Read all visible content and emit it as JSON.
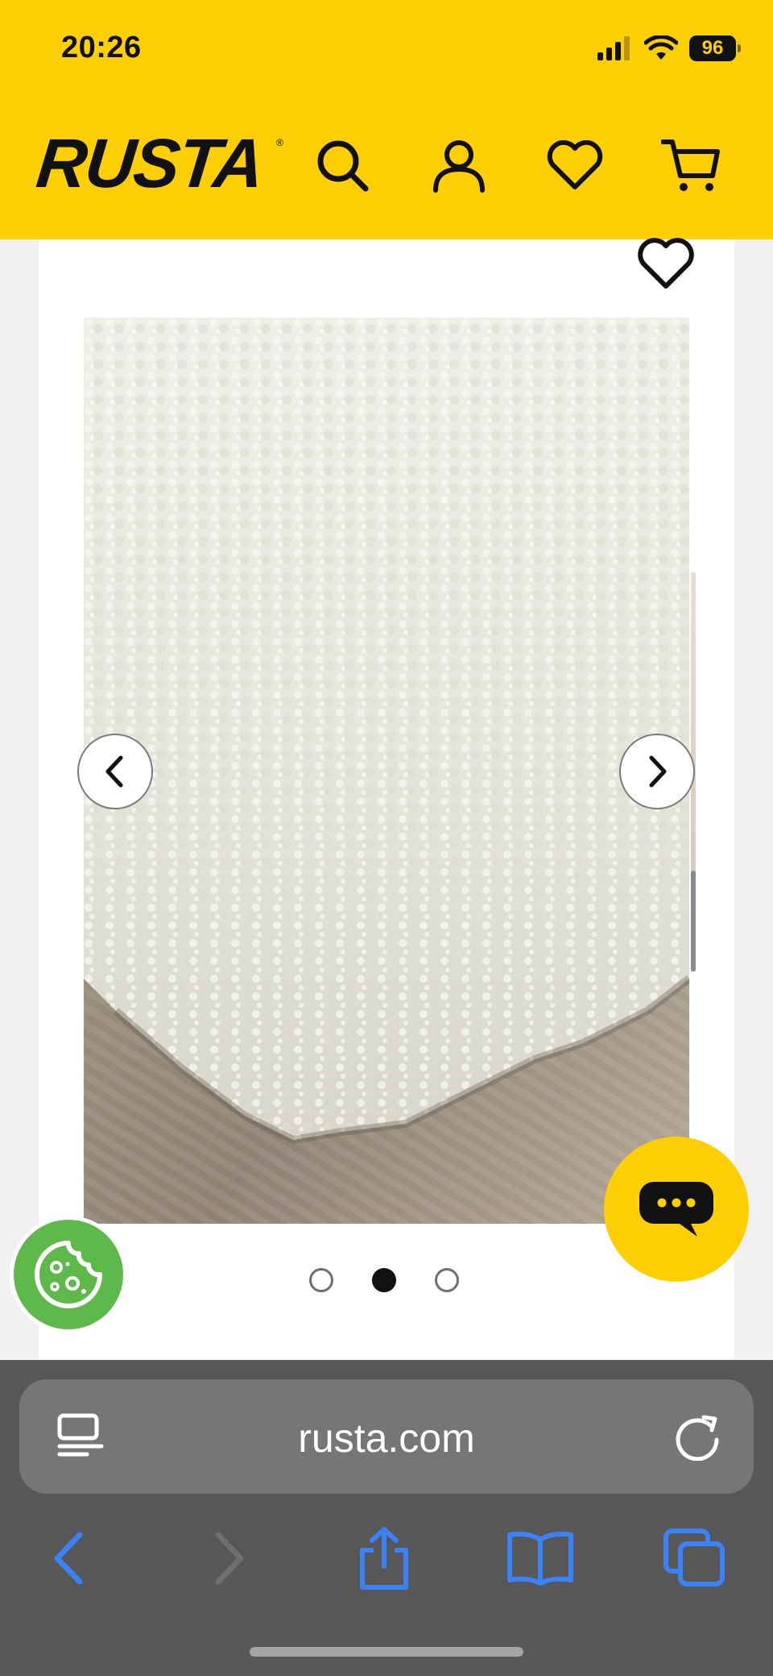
{
  "status_bar": {
    "time": "20:26",
    "battery": "96"
  },
  "header": {
    "logo": "RUSTA",
    "logo_mark": "®",
    "icons": [
      "search-icon",
      "account-icon",
      "heart-icon",
      "cart-icon"
    ]
  },
  "colors": {
    "brand_yellow": "#ffcf06",
    "cookie_green": "#5fb94a",
    "browser_accent": "#3b82f6"
  },
  "product": {
    "image": "white shaggy rug on wooden floor",
    "carousel": {
      "total": 3,
      "active_index": 2
    }
  },
  "widgets": {
    "chat": "chat-bubble-icon",
    "cookies": "cookie-icon"
  },
  "browser": {
    "url": "rusta.com"
  }
}
